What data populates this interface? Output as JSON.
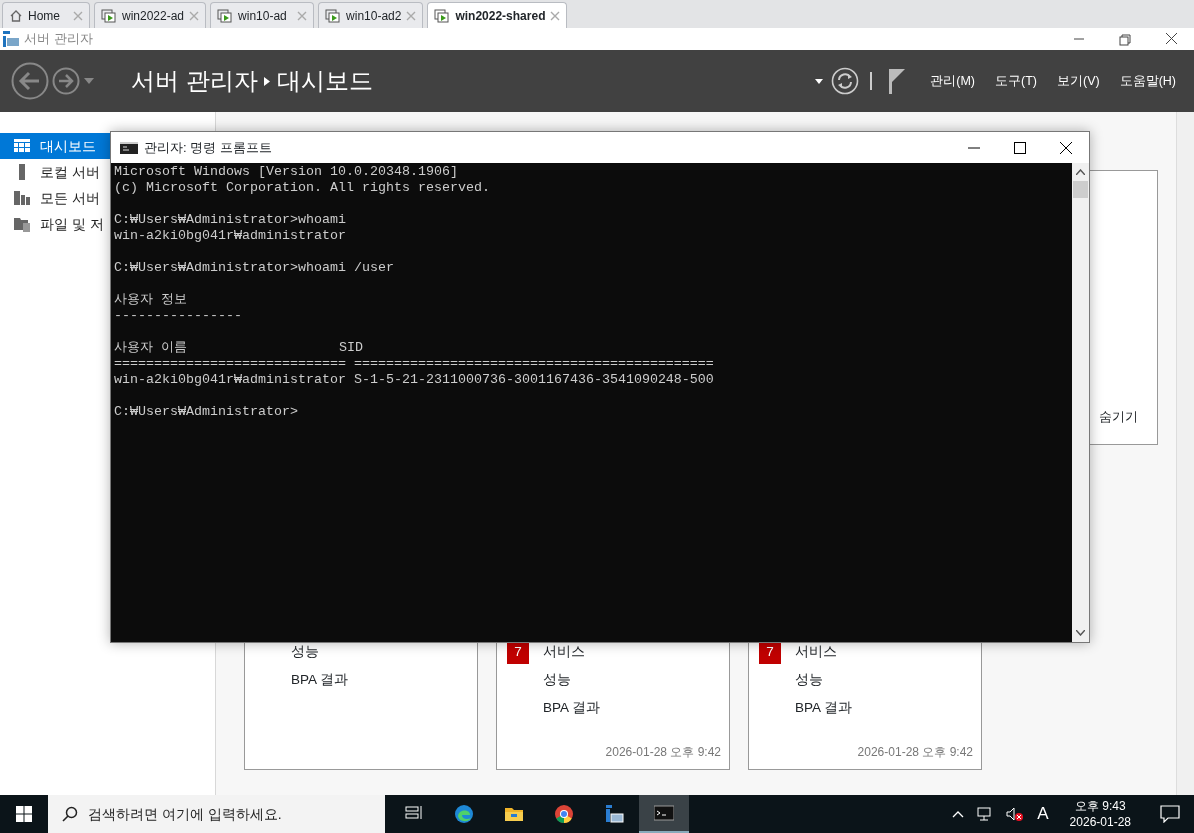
{
  "browser_tabs": [
    {
      "label": "Home",
      "kind": "home",
      "selected": false
    },
    {
      "label": "win2022-ad",
      "kind": "vm",
      "selected": false
    },
    {
      "label": "win10-ad",
      "kind": "vm",
      "selected": false
    },
    {
      "label": "win10-ad2",
      "kind": "vm",
      "selected": false
    },
    {
      "label": "win2022-shared",
      "kind": "vm",
      "selected": true
    }
  ],
  "window": {
    "title": "서버 관리자"
  },
  "header": {
    "breadcrumb": [
      "서버 관리자",
      "대시보드"
    ],
    "menu": [
      "관리(M)",
      "도구(T)",
      "보기(V)",
      "도움말(H)"
    ]
  },
  "sidebar": {
    "items": [
      {
        "label": "대시보드",
        "kind": "dashboard",
        "selected": true
      },
      {
        "label": "로컬 서버",
        "kind": "server",
        "selected": false
      },
      {
        "label": "모든 서버",
        "kind": "servers",
        "selected": false
      },
      {
        "label": "파일 및 저",
        "kind": "files",
        "selected": false
      }
    ]
  },
  "welcome_panel": {
    "hide_link": "숨기기"
  },
  "cards": [
    {
      "items": [
        {
          "label": "성능"
        },
        {
          "label": "BPA 결과"
        }
      ]
    },
    {
      "items": [
        {
          "badge": "7",
          "label": "서비스"
        },
        {
          "label": "성능"
        },
        {
          "label": "BPA 결과"
        }
      ],
      "timestamp": "2026-01-28 오후 9:42"
    },
    {
      "items": [
        {
          "badge": "7",
          "label": "서비스"
        },
        {
          "label": "성능"
        },
        {
          "label": "BPA 결과"
        }
      ],
      "timestamp": "2026-01-28 오후 9:42"
    }
  ],
  "console": {
    "title": "관리자: 명령 프롬프트",
    "blocks": [
      [
        "Microsoft Windows [Version 10.0.20348.1906]",
        "(c) Microsoft Corporation. All rights reserved."
      ],
      [
        "C:₩Users₩Administrator>whoami",
        "win-a2ki0bg041r₩administrator"
      ],
      [
        "C:₩Users₩Administrator>whoami /user"
      ],
      [
        "사용자 정보",
        "----------------"
      ],
      [
        "사용자 이름                   SID",
        "============================= =============================================",
        "win-a2ki0bg041r₩administrator S-1-5-21-2311000736-3001167436-3541090248-500"
      ],
      [
        "C:₩Users₩Administrator>"
      ]
    ]
  },
  "taskbar": {
    "search": {
      "placeholder": "검색하려면 여기에 입력하세요."
    },
    "apps": [
      {
        "kind": "taskview",
        "selected": false
      },
      {
        "kind": "edge",
        "selected": false
      },
      {
        "kind": "folder",
        "selected": false
      },
      {
        "kind": "chrome",
        "selected": false
      },
      {
        "kind": "servermanager",
        "selected": false
      },
      {
        "kind": "terminal",
        "selected": true
      }
    ],
    "ime": "A",
    "time": "오후 9:43",
    "date": "2026-01-28"
  }
}
